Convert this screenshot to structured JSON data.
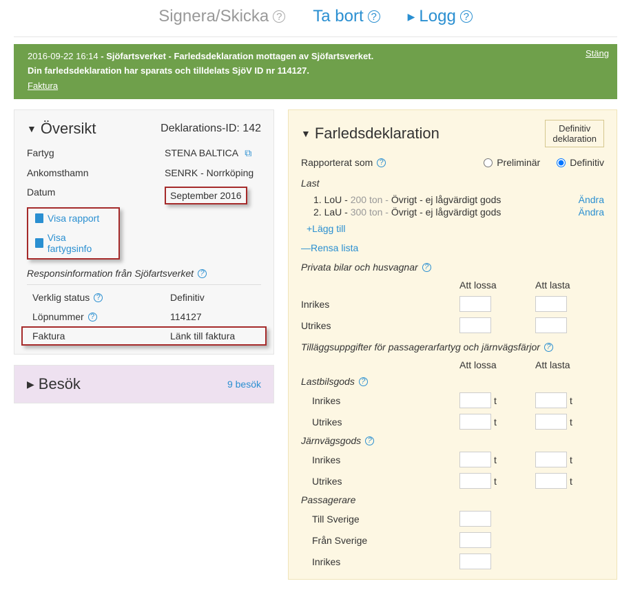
{
  "tabs": {
    "sign": "Signera/Skicka",
    "delete": "Ta bort",
    "log": "Logg"
  },
  "notification": {
    "timestamp": "2016-09-22 16:14",
    "line1_bold": " - Sjöfartsverket - Farledsdeklaration mottagen av Sjöfartsverket.",
    "line2": "Din farledsdeklaration har sparats och tilldelats SjöV ID nr 114127.",
    "faktura_link": "Faktura",
    "close": "Stäng"
  },
  "oversikt": {
    "title": "Översikt",
    "decl_id_label": "Deklarations-ID:",
    "decl_id": "142",
    "fartyg_label": "Fartyg",
    "fartyg_val": "STENA BALTICA",
    "ankomst_label": "Ankomsthamn",
    "ankomst_val": "SENRK - Norrköping",
    "datum_label": "Datum",
    "datum_val": "September 2016",
    "visa_rapport": "Visa rapport",
    "visa_fartyg": "Visa fartygsinfo",
    "respons_label": "Responsinformation från Sjöfartsverket",
    "verklig_status_label": "Verklig status",
    "verklig_status_val": "Definitiv",
    "lop_label": "Löpnummer",
    "lop_val": "114127",
    "faktura_label": "Faktura",
    "faktura_link": "Länk till faktura"
  },
  "besok": {
    "title": "Besök",
    "count": "9 besök"
  },
  "farled": {
    "title": "Farledsdeklaration",
    "badge_l1": "Definitiv",
    "badge_l2": "deklaration",
    "rapporterat": "Rapporterat som",
    "preliminar": "Preliminär",
    "definitiv": "Definitiv",
    "last_header": "Last",
    "items": [
      {
        "num": "1.",
        "code": "LoU - ",
        "grey": "200 ton - ",
        "rest": "Övrigt - ej lågvärdigt gods",
        "andra": "Ändra"
      },
      {
        "num": "2.",
        "code": "LaU - ",
        "grey": "300 ton - ",
        "rest": "Övrigt - ej lågvärdigt gods",
        "andra": "Ändra"
      }
    ],
    "lagg_till": "+Lägg till",
    "rensa": "—Rensa lista",
    "privata_header": "Privata bilar och husvagnar",
    "att_lossa": "Att lossa",
    "att_lasta": "Att lasta",
    "inrikes": "Inrikes",
    "utrikes": "Utrikes",
    "tillagg_header": "Tilläggsuppgifter för passagerarfartyg och järnvägsfärjor",
    "lastbils": "Lastbilsgods",
    "jarnvag": "Järnvägsgods",
    "passagerare": "Passagerare",
    "till_sv": "Till Sverige",
    "fran_sv": "Från Sverige",
    "unit_t": "t"
  }
}
